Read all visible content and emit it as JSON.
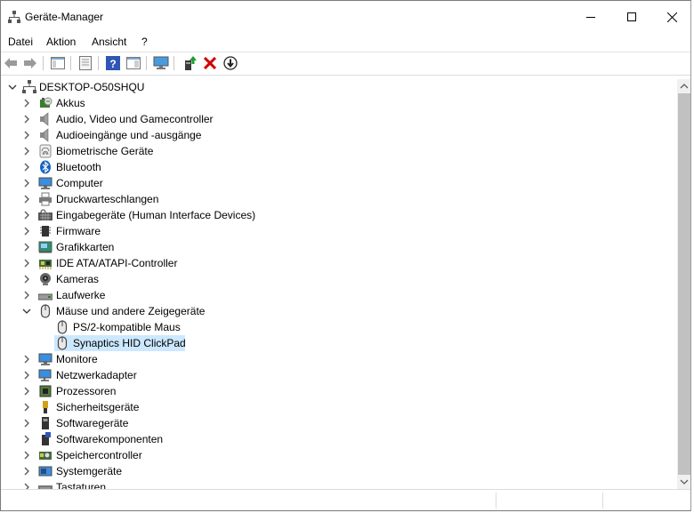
{
  "window": {
    "title": "Geräte-Manager"
  },
  "menu": [
    "Datei",
    "Aktion",
    "Ansicht",
    "?"
  ],
  "toolbar": {
    "buttons": [
      "back-arrow-icon",
      "forward-arrow-icon",
      "show-hide-console-tree-icon",
      "properties-icon",
      "help-icon",
      "action-pane-icon",
      "monitor-icon",
      "update-driver-icon",
      "uninstall-device-icon",
      "disable-device-icon"
    ]
  },
  "tree": {
    "root": "DESKTOP-O50SHQU",
    "categories": [
      {
        "label": "Akkus",
        "icon": "battery-icon"
      },
      {
        "label": "Audio, Video und Gamecontroller",
        "icon": "speaker-icon"
      },
      {
        "label": "Audioeingänge und -ausgänge",
        "icon": "speaker-icon"
      },
      {
        "label": "Biometrische Geräte",
        "icon": "fingerprint-icon"
      },
      {
        "label": "Bluetooth",
        "icon": "bluetooth-icon"
      },
      {
        "label": "Computer",
        "icon": "computer-icon"
      },
      {
        "label": "Druckwarteschlangen",
        "icon": "printer-icon"
      },
      {
        "label": "Eingabegeräte (Human Interface Devices)",
        "icon": "keyboard-hid-icon"
      },
      {
        "label": "Firmware",
        "icon": "chip-icon"
      },
      {
        "label": "Grafikkarten",
        "icon": "display-adapter-icon"
      },
      {
        "label": "IDE ATA/ATAPI-Controller",
        "icon": "ide-controller-icon"
      },
      {
        "label": "Kameras",
        "icon": "camera-icon"
      },
      {
        "label": "Laufwerke",
        "icon": "disk-drive-icon"
      },
      {
        "label": "Mäuse und andere Zeigegeräte",
        "icon": "mouse-icon",
        "expanded": true,
        "children": [
          {
            "label": "PS/2-kompatible Maus",
            "icon": "mouse-icon"
          },
          {
            "label": "Synaptics HID ClickPad",
            "icon": "mouse-icon",
            "selected": true
          }
        ]
      },
      {
        "label": "Monitore",
        "icon": "monitor-icon"
      },
      {
        "label": "Netzwerkadapter",
        "icon": "network-adapter-icon"
      },
      {
        "label": "Prozessoren",
        "icon": "processor-icon"
      },
      {
        "label": "Sicherheitsgeräte",
        "icon": "security-key-icon"
      },
      {
        "label": "Softwaregeräte",
        "icon": "software-device-icon"
      },
      {
        "label": "Softwarekomponenten",
        "icon": "software-component-icon"
      },
      {
        "label": "Speichercontroller",
        "icon": "storage-controller-icon"
      },
      {
        "label": "Systemgeräte",
        "icon": "system-device-icon"
      },
      {
        "label": "Tastaturen",
        "icon": "keyboard-icon"
      }
    ]
  },
  "colors": {
    "selection": "#cce8ff",
    "accent": "#0078d7",
    "delete_red": "#d40000"
  }
}
